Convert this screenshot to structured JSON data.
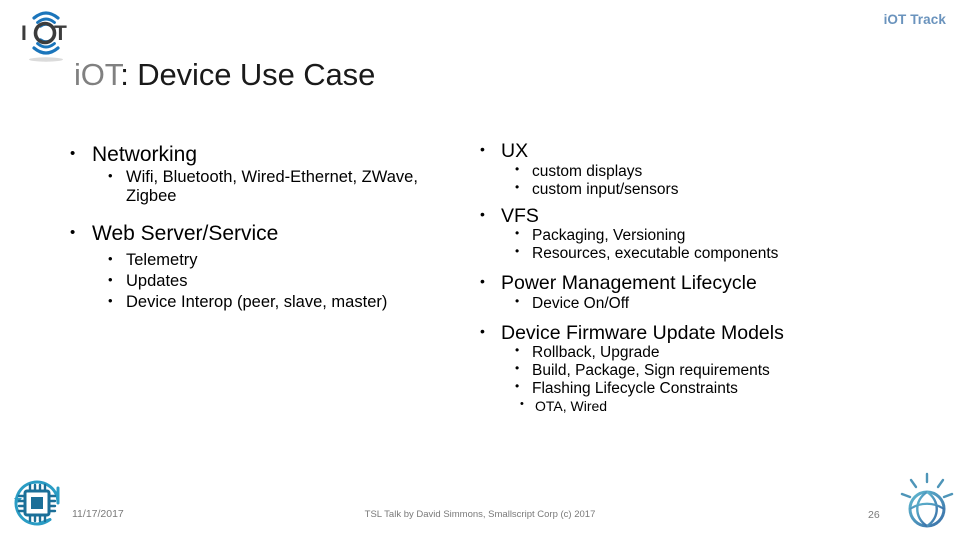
{
  "header": {
    "track_label": "iOT Track",
    "logo_text": "IOT",
    "logo_name": "iot-wifi-logo"
  },
  "title": {
    "prefix": "iOT",
    "prefix_color": "#808080",
    "rest": ": Device Use Case",
    "full": "iOT: Device Use Case"
  },
  "colors": {
    "accent_blue": "#6a93bd",
    "logo_blue": "#1b75bb",
    "icon_teal": "#2a9cc4",
    "text": "#000000",
    "footer_text": "#7a7a7a"
  },
  "left_column": [
    {
      "label": "Networking",
      "children": [
        {
          "label": "Wifi, Bluetooth, Wired-Ethernet, ZWave, Zigbee"
        }
      ]
    },
    {
      "label": "Web Server/Service",
      "children": [
        {
          "label": "Telemetry"
        },
        {
          "label": "Updates"
        },
        {
          "label": "Device Interop (peer, slave, master)"
        }
      ]
    }
  ],
  "right_column": [
    {
      "label": "UX",
      "children": [
        {
          "label": "custom displays"
        },
        {
          "label": "custom input/sensors"
        }
      ]
    },
    {
      "label": "VFS",
      "children": [
        {
          "label": "Packaging, Versioning"
        },
        {
          "label": "Resources, executable components"
        }
      ]
    },
    {
      "label": "Power Management Lifecycle",
      "children": [
        {
          "label": "Device On/Off"
        }
      ]
    },
    {
      "label": "Device Firmware Update Models",
      "children": [
        {
          "label": "Rollback, Upgrade"
        },
        {
          "label": "Build, Package, Sign requirements"
        },
        {
          "label": "Flashing Lifecycle Constraints",
          "children": [
            {
              "label": "OTA, Wired"
            }
          ]
        }
      ]
    }
  ],
  "footer": {
    "date": "11/17/2017",
    "center": "TSL Talk by David Simmons, Smallscript Corp (c) 2017",
    "page_number": "26",
    "left_icon_name": "microchip-refresh-icon",
    "right_icon_name": "lightbulb-globe-icon"
  }
}
